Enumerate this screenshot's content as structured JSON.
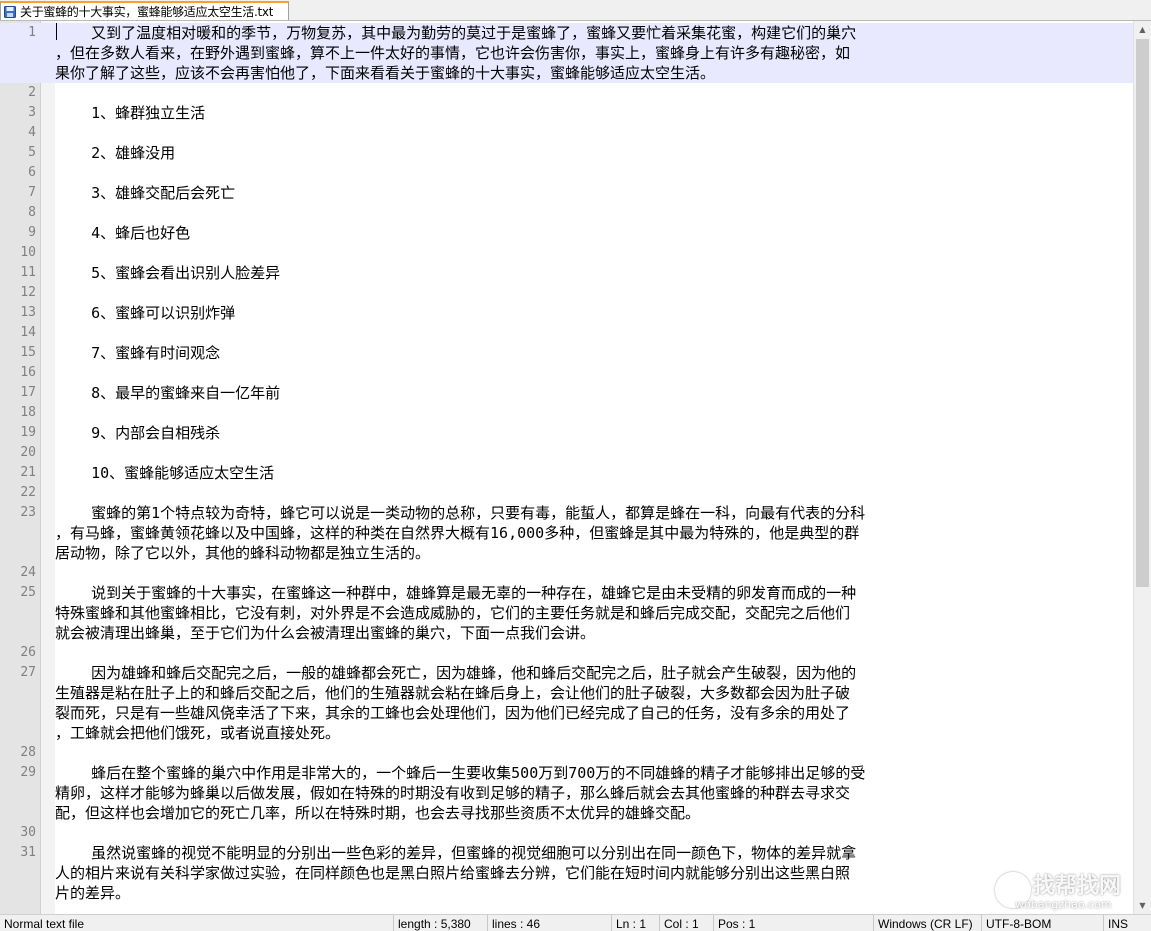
{
  "tab": {
    "title": "关于蜜蜂的十大事实，蜜蜂能够适应太空生活.txt"
  },
  "lines": [
    {
      "no": "1",
      "rows": [
        "    又到了温度相对暖和的季节，万物复苏，其中最为勤劳的莫过于是蜜蜂了，蜜蜂又要忙着采集花蜜，构建它们的巢穴",
        "，但在多数人看来，在野外遇到蜜蜂，算不上一件太好的事情，它也许会伤害你，事实上，蜜蜂身上有许多有趣秘密，如",
        "果你了解了这些，应该不会再害怕他了，下面来看看关于蜜蜂的十大事实，蜜蜂能够适应太空生活。"
      ]
    },
    {
      "no": "2",
      "rows": [
        ""
      ]
    },
    {
      "no": "3",
      "rows": [
        "    1、蜂群独立生活"
      ]
    },
    {
      "no": "4",
      "rows": [
        ""
      ]
    },
    {
      "no": "5",
      "rows": [
        "    2、雄蜂没用"
      ]
    },
    {
      "no": "6",
      "rows": [
        ""
      ]
    },
    {
      "no": "7",
      "rows": [
        "    3、雄蜂交配后会死亡"
      ]
    },
    {
      "no": "8",
      "rows": [
        ""
      ]
    },
    {
      "no": "9",
      "rows": [
        "    4、蜂后也好色"
      ]
    },
    {
      "no": "10",
      "rows": [
        ""
      ]
    },
    {
      "no": "11",
      "rows": [
        "    5、蜜蜂会看出识别人脸差异"
      ]
    },
    {
      "no": "12",
      "rows": [
        ""
      ]
    },
    {
      "no": "13",
      "rows": [
        "    6、蜜蜂可以识别炸弹"
      ]
    },
    {
      "no": "14",
      "rows": [
        ""
      ]
    },
    {
      "no": "15",
      "rows": [
        "    7、蜜蜂有时间观念"
      ]
    },
    {
      "no": "16",
      "rows": [
        ""
      ]
    },
    {
      "no": "17",
      "rows": [
        "    8、最早的蜜蜂来自一亿年前"
      ]
    },
    {
      "no": "18",
      "rows": [
        ""
      ]
    },
    {
      "no": "19",
      "rows": [
        "    9、内部会自相残杀"
      ]
    },
    {
      "no": "20",
      "rows": [
        ""
      ]
    },
    {
      "no": "21",
      "rows": [
        "    10、蜜蜂能够适应太空生活"
      ]
    },
    {
      "no": "22",
      "rows": [
        ""
      ]
    },
    {
      "no": "23",
      "rows": [
        "    蜜蜂的第1个特点较为奇特，蜂它可以说是一类动物的总称，只要有毒，能蜇人，都算是蜂在一科，向最有代表的分科",
        "，有马蜂，蜜蜂黄领花蜂以及中国蜂，这样的种类在自然界大概有16,000多种，但蜜蜂是其中最为特殊的，他是典型的群",
        "居动物，除了它以外，其他的蜂科动物都是独立生活的。"
      ]
    },
    {
      "no": "24",
      "rows": [
        ""
      ]
    },
    {
      "no": "25",
      "rows": [
        "    说到关于蜜蜂的十大事实，在蜜蜂这一种群中，雄蜂算是最无辜的一种存在，雄蜂它是由未受精的卵发育而成的一种",
        "特殊蜜蜂和其他蜜蜂相比，它没有刺，对外界是不会造成威胁的，它们的主要任务就是和蜂后完成交配，交配完之后他们",
        "就会被清理出蜂巢，至于它们为什么会被清理出蜜蜂的巢穴，下面一点我们会讲。"
      ]
    },
    {
      "no": "26",
      "rows": [
        ""
      ]
    },
    {
      "no": "27",
      "rows": [
        "    因为雄蜂和蜂后交配完之后，一般的雄蜂都会死亡，因为雄蜂，他和蜂后交配完之后，肚子就会产生破裂，因为他的",
        "生殖器是粘在肚子上的和蜂后交配之后，他们的生殖器就会粘在蜂后身上，会让他们的肚子破裂，大多数都会因为肚子破",
        "裂而死，只是有一些雄风侥幸活了下来，其余的工蜂也会处理他们，因为他们已经完成了自己的任务，没有多余的用处了",
        "，工蜂就会把他们饿死，或者说直接处死。"
      ]
    },
    {
      "no": "28",
      "rows": [
        ""
      ]
    },
    {
      "no": "29",
      "rows": [
        "    蜂后在整个蜜蜂的巢穴中作用是非常大的，一个蜂后一生要收集500万到700万的不同雄蜂的精子才能够排出足够的受",
        "精卵，这样才能够为蜂巢以后做发展，假如在特殊的时期没有收到足够的精子，那么蜂后就会去其他蜜蜂的种群去寻求交",
        "配，但这样也会增加它的死亡几率，所以在特殊时期，也会去寻找那些资质不太优异的雄蜂交配。"
      ]
    },
    {
      "no": "30",
      "rows": [
        ""
      ]
    },
    {
      "no": "31",
      "rows": [
        "    虽然说蜜蜂的视觉不能明显的分别出一些色彩的差异，但蜜蜂的视觉细胞可以分别出在同一颜色下，物体的差异就拿",
        "人的相片来说有关科学家做过实验，在同样颜色也是黑白照片给蜜蜂去分辨，它们能在短时间内就能够分别出这些黑白照",
        "片的差异。"
      ]
    }
  ],
  "status": {
    "file_type": "Normal text file",
    "length": "length : 5,380",
    "lines": "lines : 46",
    "ln": "Ln : 1",
    "col": "Col : 1",
    "pos": "Pos : 1",
    "eol": "Windows (CR LF)",
    "encoding": "UTF-8-BOM",
    "mode": "INS"
  },
  "watermark": {
    "title": "找帮找网",
    "url": "wobangzhao.com"
  }
}
